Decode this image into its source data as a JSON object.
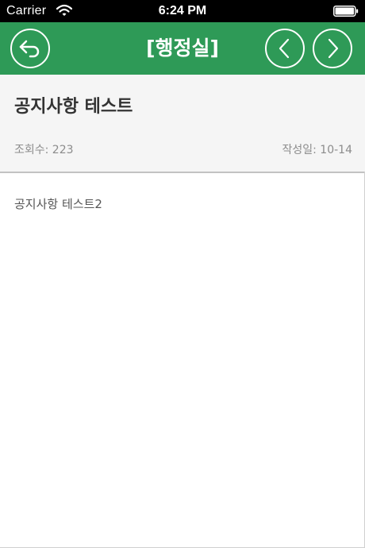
{
  "status_bar": {
    "carrier": "Carrier",
    "time": "6:24 PM",
    "icons": [
      "wifi-icon",
      "battery-icon"
    ]
  },
  "nav": {
    "title": "[행정실]",
    "background_color": "#2e9a57",
    "back_icon": "return-arrow-icon",
    "prev_icon": "chevron-left-icon",
    "next_icon": "chevron-right-icon"
  },
  "post": {
    "title": "공지사항 테스트",
    "view_count": "조회수: 223",
    "written_date": "작성일: 10-14",
    "body": "공지사항 테스트2"
  }
}
